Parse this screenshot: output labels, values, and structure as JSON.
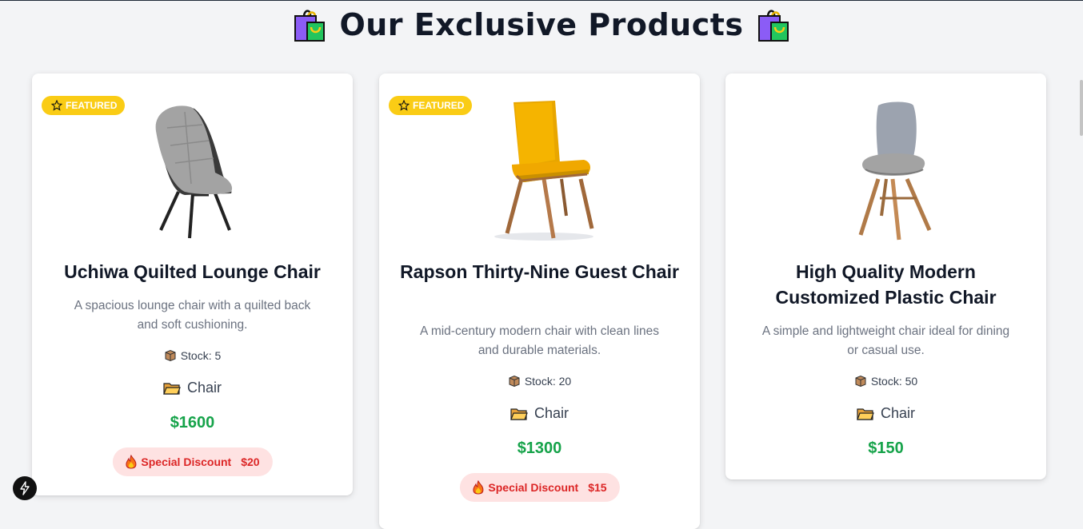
{
  "page": {
    "title": "Our Exclusive Products",
    "title_icon": "shopping-bags-icon"
  },
  "colors": {
    "price": "#16a34a",
    "featured_badge": "#facc15",
    "discount_bg": "#fee2e2",
    "discount_text": "#dc2626"
  },
  "products": [
    {
      "featured": true,
      "featured_label": "FEATURED",
      "name": "Uchiwa Quilted Lounge Chair",
      "description": "A spacious lounge chair with a quilted back and soft cushioning.",
      "stock": "Stock: 5",
      "category": "Chair",
      "price": "$1600",
      "discount_label": "Special Discount",
      "discount_amount": "$20"
    },
    {
      "featured": true,
      "featured_label": "FEATURED",
      "name": "Rapson Thirty-Nine Guest Chair",
      "description": "A mid-century modern chair with clean lines and durable materials.",
      "stock": "Stock: 20",
      "category": "Chair",
      "price": "$1300",
      "discount_label": "Special Discount",
      "discount_amount": "$15"
    },
    {
      "featured": false,
      "name": "High Quality Modern Customized Plastic Chair",
      "description": "A simple and lightweight chair ideal for dining or casual use.",
      "stock": "Stock: 50",
      "category": "Chair",
      "price": "$150"
    }
  ]
}
